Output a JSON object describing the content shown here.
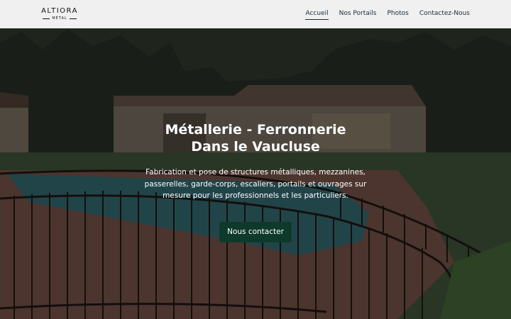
{
  "brand": {
    "name": "ALTIORA",
    "sub": "MÉTAL"
  },
  "nav": {
    "items": [
      {
        "label": "Accueil",
        "active": true
      },
      {
        "label": "Nos Portails",
        "active": false
      },
      {
        "label": "Photos",
        "active": false
      },
      {
        "label": "Contactez-Nous",
        "active": false
      }
    ]
  },
  "hero": {
    "title_line1": "Métallerie - Ferronnerie",
    "title_line2": "Dans le Vaucluse",
    "description": "Fabrication et pose de structures métalliques, mezzanines, passerelles, garde-corps, escaliers, portails et ouvrages sur mesure pour les professionnels et les particuliers.",
    "cta_label": "Nous contacter",
    "background": "photo of a backyard pool enclosed by a curved black metal fence in front of a house with a tiled roof and trees"
  },
  "colors": {
    "header_bg": "#f0f0f0",
    "nav_text": "#1e2a3a",
    "cta_bg": "#0e3a2c",
    "hero_text": "#ffffff"
  }
}
